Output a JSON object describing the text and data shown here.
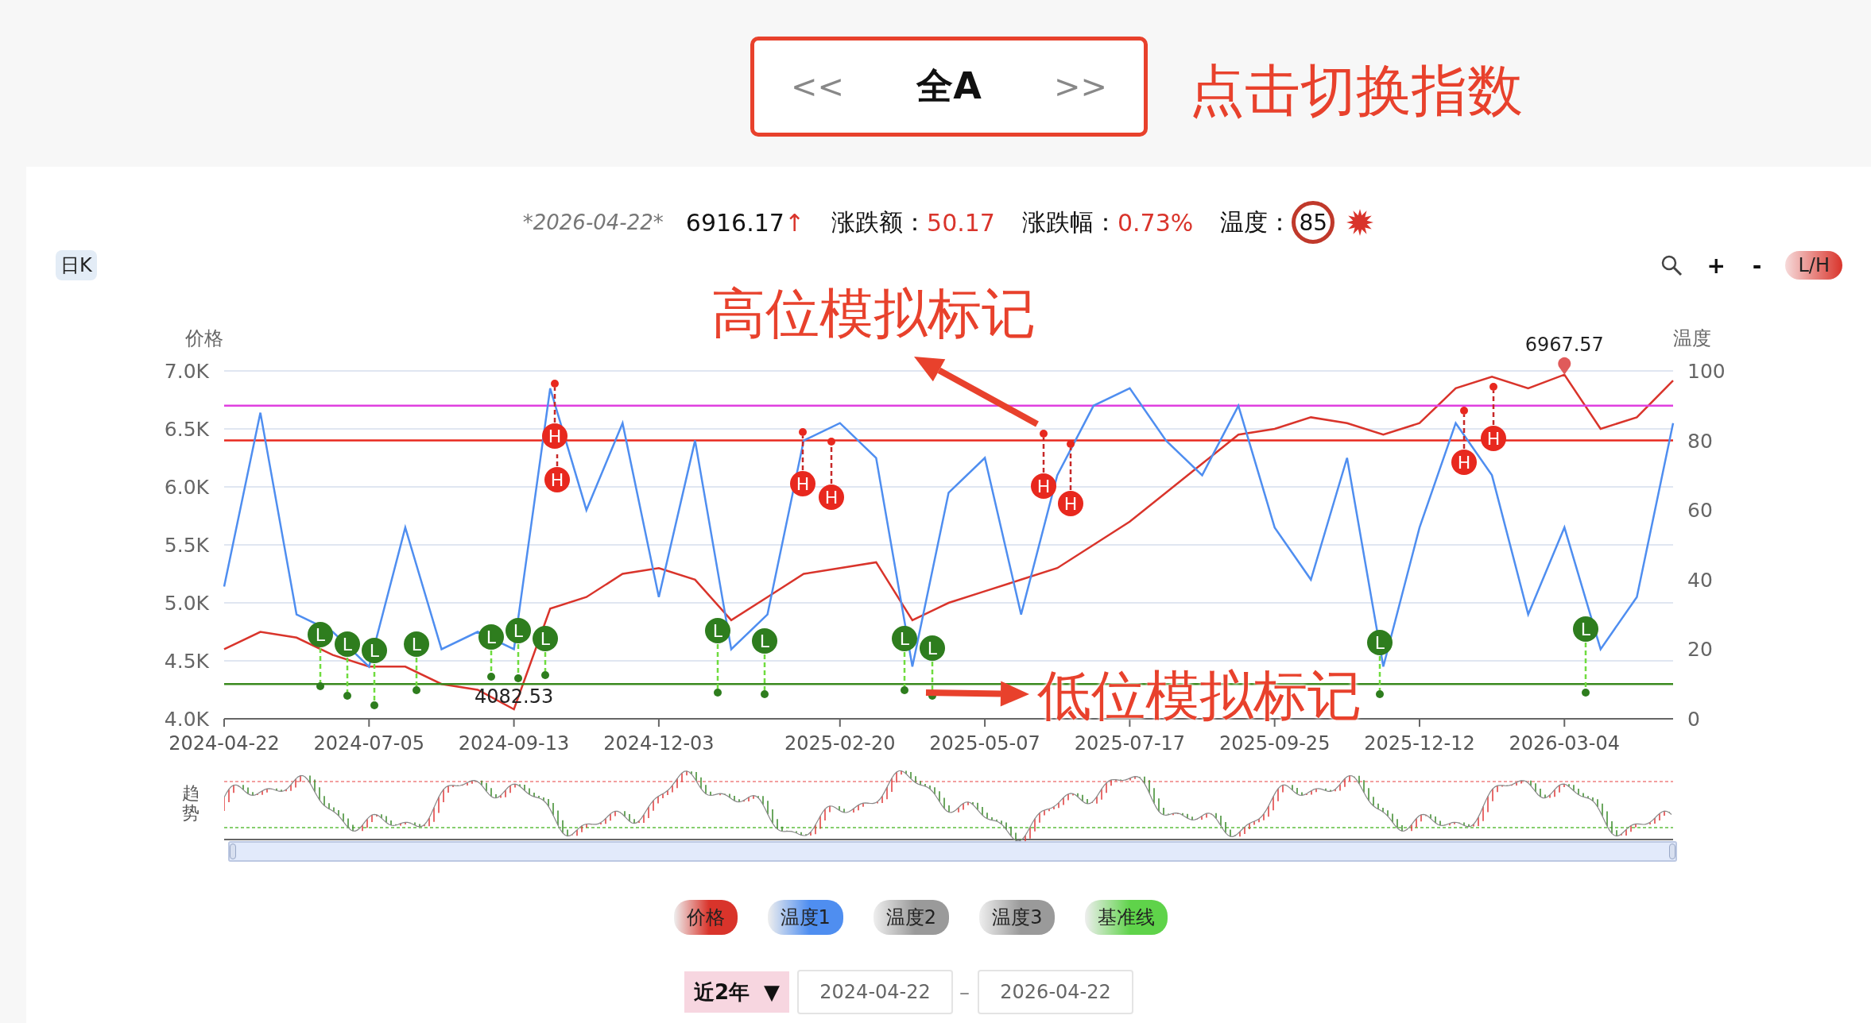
{
  "index_switcher": {
    "prev": "<<",
    "title": "全A",
    "next": ">>",
    "hint": "点击切换指数"
  },
  "quote": {
    "date": "*2026-04-22*",
    "price": "6916.17",
    "arrow": "↑",
    "change_label": "涨跌额：",
    "change": "50.17",
    "pct_label": "涨跌幅：",
    "pct": "0.73%",
    "temp_label": "温度：",
    "temp": "85"
  },
  "period_tab": "日K",
  "toolbar": {
    "zoom_in": "+",
    "zoom_out": "-",
    "toggle": "L/H"
  },
  "callouts": [
    {
      "text": "高位模拟标记"
    },
    {
      "text": "低位模拟标记"
    }
  ],
  "price_chart": {
    "chart_data": {
      "type": "line",
      "ylabel": "价格",
      "ylim": [
        4000,
        7000
      ],
      "grid": true,
      "yticks": [
        {
          "value": 4000,
          "label": "4.0K"
        },
        {
          "value": 4500,
          "label": "4.5K"
        },
        {
          "value": 5000,
          "label": "5.0K"
        },
        {
          "value": 5500,
          "label": "5.5K"
        },
        {
          "value": 6000,
          "label": "6.0K"
        },
        {
          "value": 6500,
          "label": "6.5K"
        },
        {
          "value": 7000,
          "label": "7.0K"
        }
      ],
      "categories": [
        "2024-04-22",
        null,
        null,
        null,
        "2024-07-05",
        null,
        null,
        null,
        "2024-09-13",
        null,
        null,
        null,
        "2024-12-03",
        null,
        null,
        null,
        null,
        "2025-02-20",
        null,
        null,
        null,
        "2025-05-07",
        null,
        null,
        null,
        "2025-07-17",
        null,
        null,
        null,
        "2025-09-25",
        null,
        null,
        null,
        "2025-12-12",
        null,
        null,
        null,
        "2026-03-04",
        null,
        null,
        null
      ],
      "values": [
        4600,
        4750,
        4700,
        4550,
        4450,
        4450,
        4300,
        4250,
        4082.53,
        4950,
        5050,
        5250,
        5300,
        5200,
        4850,
        5050,
        5250,
        5300,
        5350,
        4850,
        5000,
        5100,
        5200,
        5300,
        5500,
        5700,
        5950,
        6200,
        6450,
        6500,
        6600,
        6550,
        6450,
        6550,
        6850,
        6950,
        6850,
        6967.57,
        6500,
        6600,
        6916.17
      ],
      "annotations": [
        "4082.53",
        "6967.57"
      ]
    }
  },
  "temperature_chart": {
    "chart_data": {
      "type": "line",
      "ylabel": "温度",
      "ylim": [
        0,
        100
      ],
      "yticks": [
        0,
        20,
        40,
        60,
        80,
        100
      ],
      "categories": [
        null,
        null,
        null,
        null,
        null,
        null,
        null,
        null,
        null,
        null,
        null,
        null,
        null,
        null,
        null,
        null,
        null,
        null,
        null,
        null,
        null,
        null,
        null,
        null,
        null,
        null,
        null,
        null,
        null,
        null,
        null,
        null,
        null,
        null,
        null,
        null,
        null,
        null,
        null,
        null,
        null
      ],
      "ref_lines": [
        {
          "axis": "y",
          "value": 90,
          "color": "#e040e0"
        },
        {
          "axis": "y",
          "value": 80,
          "color": "#e8281e"
        },
        {
          "axis": "y",
          "value": 10,
          "color": "#3a8a1e"
        }
      ],
      "values": [
        38,
        88,
        30,
        25,
        15,
        55,
        20,
        25,
        20,
        95,
        60,
        85,
        35,
        80,
        20,
        30,
        80,
        85,
        75,
        15,
        65,
        75,
        30,
        70,
        90,
        95,
        80,
        70,
        90,
        55,
        40,
        75,
        15,
        55,
        85,
        70,
        30,
        55,
        20,
        35,
        85
      ],
      "annotations": [
        "H",
        "H",
        "H",
        "H",
        "H",
        "H",
        "H",
        "H",
        "L",
        "L",
        "L",
        "L",
        "L",
        "L",
        "L",
        "L",
        "L",
        "L",
        "L",
        "L",
        "L"
      ]
    }
  },
  "trend": {
    "label": "趋势"
  },
  "slider": {
    "level": 1
  },
  "legend": [
    {
      "label": "价格",
      "color": "#d9342b"
    },
    {
      "label": "温度1",
      "color": "#4f8ef0"
    },
    {
      "label": "温度2",
      "color": "#9a9a9a"
    },
    {
      "label": "温度3",
      "color": "#9a9a9a"
    },
    {
      "label": "基准线",
      "color": "#5fd34a"
    }
  ],
  "range": {
    "preset": "近2年",
    "caret": "▼",
    "start": "2024-04-22",
    "separator": "–",
    "end": "2026-04-22"
  }
}
